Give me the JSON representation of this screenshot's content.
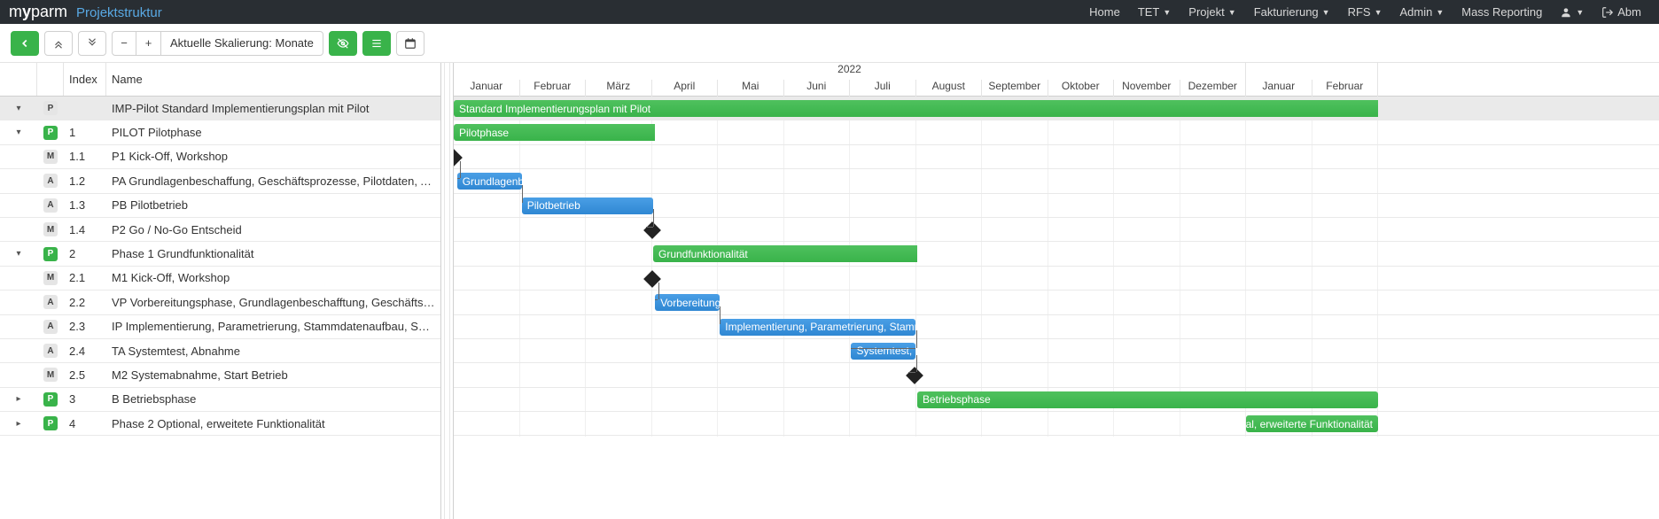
{
  "nav": {
    "brand_main": "myparm",
    "brand_sub": "Projektstruktur",
    "items": [
      "Home",
      "TET",
      "Projekt",
      "Fakturierung",
      "RFS",
      "Admin",
      "Mass Reporting"
    ],
    "user_label": "Abm"
  },
  "toolbar": {
    "scale_label": "Aktuelle Skalierung: Monate"
  },
  "columns": {
    "index": "Index",
    "name": "Name"
  },
  "timeline": {
    "year": "2022",
    "months": [
      "Januar",
      "Februar",
      "März",
      "April",
      "Mai",
      "Juni",
      "Juli",
      "August",
      "September",
      "Oktober",
      "November",
      "Dezember",
      "Januar",
      "Februar"
    ],
    "month_width": 74.5,
    "left_offset": 0
  },
  "rows": [
    {
      "type": "P_plain",
      "expand": "down",
      "idx": "",
      "name": "IMP-Pilot Standard Implementierungsplan mit Pilot",
      "bar": {
        "kind": "greensum",
        "label": "Standard Implementierungsplan mit Pilot",
        "from_m": 0,
        "to_m": 14
      },
      "header": true
    },
    {
      "type": "P",
      "expand": "down_sm",
      "idx": "1",
      "name": "PILOT Pilotphase",
      "bar": {
        "kind": "greensum",
        "label": "Pilotphase",
        "from_m": 0,
        "to_m": 3.05
      }
    },
    {
      "type": "M",
      "idx": "1.1",
      "name": "P1 Kick-Off, Workshop",
      "milestone_m": 0.0,
      "conn_down": true
    },
    {
      "type": "A",
      "idx": "1.2",
      "name": "PA Grundlagenbeschaffung, Geschäftsprozesse, Pilotdaten, Aufbau Pilotsystem",
      "bar": {
        "kind": "blue",
        "label": "Grundlagenb...",
        "from_m": 0.05,
        "to_m": 1.03
      },
      "conn_down": true
    },
    {
      "type": "A",
      "idx": "1.3",
      "name": "PB Pilotbetrieb",
      "bar": {
        "kind": "blue",
        "label": "Pilotbetrieb",
        "from_m": 1.03,
        "to_m": 3.02
      },
      "conn_down": true
    },
    {
      "type": "M",
      "idx": "1.4",
      "name": "P2 Go / No-Go Entscheid",
      "milestone_m": 3.0
    },
    {
      "type": "P",
      "expand": "down_sm",
      "idx": "2",
      "name": "Phase 1 Grundfunktionalität",
      "bar": {
        "kind": "greensum",
        "label": "Grundfunktionalität",
        "from_m": 3.02,
        "to_m": 7.02
      }
    },
    {
      "type": "M",
      "idx": "2.1",
      "name": "M1 Kick-Off, Workshop",
      "milestone_m": 3.0,
      "conn_down": true
    },
    {
      "type": "A",
      "idx": "2.2",
      "name": "VP Vorbereitungsphase, Grundlagenbeschafftung, Geschäftsprozesse",
      "bar": {
        "kind": "blue",
        "label": "Vorbereitung...",
        "from_m": 3.05,
        "to_m": 4.03
      },
      "conn_down": true
    },
    {
      "type": "A",
      "idx": "2.3",
      "name": "IP Implementierung, Parametrierung, Stammdatenaufbau, Schulung",
      "bar": {
        "kind": "blue",
        "label": "Implementierung, Parametrierung, Stammdat...",
        "from_m": 4.03,
        "to_m": 7.0
      },
      "conn_down": true
    },
    {
      "type": "A",
      "idx": "2.4",
      "name": "TA Systemtest, Abnahme",
      "bar": {
        "kind": "blue",
        "label": "Systemtest, ...",
        "from_m": 6.02,
        "to_m": 7.0
      },
      "conn_down": true
    },
    {
      "type": "M",
      "idx": "2.5",
      "name": "M2 Systemabnahme, Start Betrieb",
      "milestone_m": 6.98
    },
    {
      "type": "P",
      "expand": "right",
      "idx": "3",
      "name": "B Betriebsphase",
      "bar": {
        "kind": "green",
        "label": "Betriebsphase",
        "from_m": 7.02,
        "to_m": 14
      }
    },
    {
      "type": "P",
      "expand": "right",
      "idx": "4",
      "name": "Phase 2 Optional, erweitete Funktionalität",
      "bar": {
        "kind": "green",
        "label": "Optional, erweiterte Funktionalität",
        "from_m": 12.0,
        "to_m": 14,
        "align_right": true
      }
    }
  ]
}
